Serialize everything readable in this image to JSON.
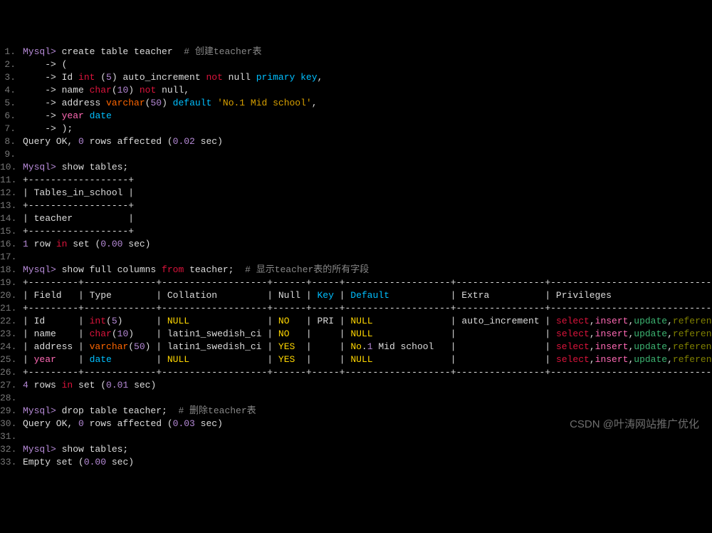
{
  "lines": {
    "1": {
      "num": "1.",
      "parts": [
        {
          "t": "Mysql>",
          "c": "prompt"
        },
        {
          "t": " create table teacher  ",
          "c": "white"
        },
        {
          "t": "# 创建teacher表",
          "c": "comment"
        }
      ]
    },
    "2": {
      "num": "2.",
      "parts": [
        {
          "t": "    -> (",
          "c": "white"
        }
      ]
    },
    "3": {
      "num": "3.",
      "parts": [
        {
          "t": "    -> Id ",
          "c": "white"
        },
        {
          "t": "int",
          "c": "kw-red"
        },
        {
          "t": " (",
          "c": "white"
        },
        {
          "t": "5",
          "c": "num"
        },
        {
          "t": ") auto_increment ",
          "c": "white"
        },
        {
          "t": "not",
          "c": "kw-red"
        },
        {
          "t": " null ",
          "c": "white"
        },
        {
          "t": "primary",
          "c": "kw-cyan"
        },
        {
          "t": " ",
          "c": "white"
        },
        {
          "t": "key",
          "c": "kw-cyan"
        },
        {
          "t": ",",
          "c": "white"
        }
      ]
    },
    "4": {
      "num": "4.",
      "parts": [
        {
          "t": "    -> name ",
          "c": "white"
        },
        {
          "t": "char",
          "c": "kw-red"
        },
        {
          "t": "(",
          "c": "white"
        },
        {
          "t": "10",
          "c": "num"
        },
        {
          "t": ") ",
          "c": "white"
        },
        {
          "t": "not",
          "c": "kw-red"
        },
        {
          "t": " null,",
          "c": "white"
        }
      ]
    },
    "5": {
      "num": "5.",
      "parts": [
        {
          "t": "    -> address ",
          "c": "white"
        },
        {
          "t": "varchar",
          "c": "kw-orange"
        },
        {
          "t": "(",
          "c": "white"
        },
        {
          "t": "50",
          "c": "num"
        },
        {
          "t": ") ",
          "c": "white"
        },
        {
          "t": "default",
          "c": "kw-cyan"
        },
        {
          "t": " ",
          "c": "white"
        },
        {
          "t": "'No.1 Mid school'",
          "c": "str"
        },
        {
          "t": ",",
          "c": "white"
        }
      ]
    },
    "6": {
      "num": "6.",
      "parts": [
        {
          "t": "    -> ",
          "c": "white"
        },
        {
          "t": "year",
          "c": "kw-pink"
        },
        {
          "t": " ",
          "c": "white"
        },
        {
          "t": "date",
          "c": "kw-cyan"
        }
      ]
    },
    "7": {
      "num": "7.",
      "parts": [
        {
          "t": "    -> );",
          "c": "white"
        }
      ]
    },
    "8": {
      "num": "8.",
      "parts": [
        {
          "t": "Query OK, ",
          "c": "white"
        },
        {
          "t": "0",
          "c": "num"
        },
        {
          "t": " rows affected (",
          "c": "white"
        },
        {
          "t": "0.02",
          "c": "num"
        },
        {
          "t": " sec)",
          "c": "white"
        }
      ]
    },
    "9": {
      "num": "9.",
      "parts": [
        {
          "t": "",
          "c": "white"
        }
      ]
    },
    "10": {
      "num": "10.",
      "parts": [
        {
          "t": "Mysql>",
          "c": "prompt"
        },
        {
          "t": " show tables;",
          "c": "white"
        }
      ]
    },
    "11": {
      "num": "11.",
      "parts": [
        {
          "t": "+------------------+",
          "c": "white"
        }
      ]
    },
    "12": {
      "num": "12.",
      "parts": [
        {
          "t": "| Tables_in_school |",
          "c": "white"
        }
      ]
    },
    "13": {
      "num": "13.",
      "parts": [
        {
          "t": "+------------------+",
          "c": "white"
        }
      ]
    },
    "14": {
      "num": "14.",
      "parts": [
        {
          "t": "| teacher          |",
          "c": "white"
        }
      ]
    },
    "15": {
      "num": "15.",
      "parts": [
        {
          "t": "+------------------+",
          "c": "white"
        }
      ]
    },
    "16": {
      "num": "16.",
      "parts": [
        {
          "t": "1",
          "c": "num"
        },
        {
          "t": " row ",
          "c": "white"
        },
        {
          "t": "in",
          "c": "kw-red"
        },
        {
          "t": " set (",
          "c": "white"
        },
        {
          "t": "0.00",
          "c": "num"
        },
        {
          "t": " sec)",
          "c": "white"
        }
      ]
    },
    "17": {
      "num": "17.",
      "parts": [
        {
          "t": "",
          "c": "white"
        }
      ]
    },
    "18": {
      "num": "18.",
      "parts": [
        {
          "t": "Mysql>",
          "c": "prompt"
        },
        {
          "t": " show full columns ",
          "c": "white"
        },
        {
          "t": "from",
          "c": "kw-red"
        },
        {
          "t": " teacher;  ",
          "c": "white"
        },
        {
          "t": "# 显示teacher表的所有字段",
          "c": "comment"
        }
      ]
    },
    "19": {
      "num": "19.",
      "parts": [
        {
          "t": "+---------+-------------+-------------------+------+-----+-------------------+----------------+---------------------------------+---------+",
          "c": "white"
        }
      ]
    },
    "20": {
      "num": "20.",
      "parts": [
        {
          "t": "| Field   | Type        | Collation         | Null | ",
          "c": "white"
        },
        {
          "t": "Key",
          "c": "kw-cyan"
        },
        {
          "t": " | ",
          "c": "white"
        },
        {
          "t": "Default",
          "c": "kw-cyan"
        },
        {
          "t": "           | Extra          | Privileges                      | Comment |",
          "c": "white"
        }
      ]
    },
    "21": {
      "num": "21.",
      "parts": [
        {
          "t": "+---------+-------------+-------------------+------+-----+-------------------+----------------+---------------------------------+---------+",
          "c": "white"
        }
      ]
    },
    "22": {
      "num": "22.",
      "parts": [
        {
          "t": "| Id      | ",
          "c": "white"
        },
        {
          "t": "int",
          "c": "kw-red"
        },
        {
          "t": "(",
          "c": "white"
        },
        {
          "t": "5",
          "c": "num"
        },
        {
          "t": ")      | ",
          "c": "white"
        },
        {
          "t": "NULL",
          "c": "kw-yellow"
        },
        {
          "t": "              | ",
          "c": "white"
        },
        {
          "t": "NO",
          "c": "kw-yellow"
        },
        {
          "t": "   | PRI | ",
          "c": "white"
        },
        {
          "t": "NULL",
          "c": "kw-yellow"
        },
        {
          "t": "              | auto_increment | ",
          "c": "white"
        },
        {
          "t": "select",
          "c": "kw-red"
        },
        {
          "t": ",",
          "c": "white"
        },
        {
          "t": "insert",
          "c": "kw-pink"
        },
        {
          "t": ",",
          "c": "white"
        },
        {
          "t": "update",
          "c": "kw-green"
        },
        {
          "t": ",",
          "c": "white"
        },
        {
          "t": "references",
          "c": "kw-olive"
        },
        {
          "t": " |         |",
          "c": "white"
        }
      ]
    },
    "23": {
      "num": "23.",
      "parts": [
        {
          "t": "| name    | ",
          "c": "white"
        },
        {
          "t": "char",
          "c": "kw-red"
        },
        {
          "t": "(",
          "c": "white"
        },
        {
          "t": "10",
          "c": "num"
        },
        {
          "t": ")    | latin1_swedish_ci | ",
          "c": "white"
        },
        {
          "t": "NO",
          "c": "kw-yellow"
        },
        {
          "t": "   |     | ",
          "c": "white"
        },
        {
          "t": "NULL",
          "c": "kw-yellow"
        },
        {
          "t": "              |                | ",
          "c": "white"
        },
        {
          "t": "select",
          "c": "kw-red"
        },
        {
          "t": ",",
          "c": "white"
        },
        {
          "t": "insert",
          "c": "kw-pink"
        },
        {
          "t": ",",
          "c": "white"
        },
        {
          "t": "update",
          "c": "kw-green"
        },
        {
          "t": ",",
          "c": "white"
        },
        {
          "t": "references",
          "c": "kw-olive"
        },
        {
          "t": " |         |",
          "c": "white"
        }
      ]
    },
    "24": {
      "num": "24.",
      "parts": [
        {
          "t": "| address | ",
          "c": "white"
        },
        {
          "t": "varchar",
          "c": "kw-orange"
        },
        {
          "t": "(",
          "c": "white"
        },
        {
          "t": "50",
          "c": "num"
        },
        {
          "t": ") | latin1_swedish_ci | ",
          "c": "white"
        },
        {
          "t": "YES",
          "c": "kw-yellow"
        },
        {
          "t": "  |     | ",
          "c": "white"
        },
        {
          "t": "No",
          "c": "kw-yellow"
        },
        {
          "t": ".",
          "c": "white"
        },
        {
          "t": "1",
          "c": "num"
        },
        {
          "t": " Mid school   |                | ",
          "c": "white"
        },
        {
          "t": "select",
          "c": "kw-red"
        },
        {
          "t": ",",
          "c": "white"
        },
        {
          "t": "insert",
          "c": "kw-pink"
        },
        {
          "t": ",",
          "c": "white"
        },
        {
          "t": "update",
          "c": "kw-green"
        },
        {
          "t": ",",
          "c": "white"
        },
        {
          "t": "references",
          "c": "kw-olive"
        },
        {
          "t": " |         |",
          "c": "white"
        }
      ]
    },
    "25": {
      "num": "25.",
      "parts": [
        {
          "t": "| ",
          "c": "white"
        },
        {
          "t": "year",
          "c": "kw-pink"
        },
        {
          "t": "    | ",
          "c": "white"
        },
        {
          "t": "date",
          "c": "kw-cyan"
        },
        {
          "t": "        | ",
          "c": "white"
        },
        {
          "t": "NULL",
          "c": "kw-yellow"
        },
        {
          "t": "              | ",
          "c": "white"
        },
        {
          "t": "YES",
          "c": "kw-yellow"
        },
        {
          "t": "  |     | ",
          "c": "white"
        },
        {
          "t": "NULL",
          "c": "kw-yellow"
        },
        {
          "t": "              |                | ",
          "c": "white"
        },
        {
          "t": "select",
          "c": "kw-red"
        },
        {
          "t": ",",
          "c": "white"
        },
        {
          "t": "insert",
          "c": "kw-pink"
        },
        {
          "t": ",",
          "c": "white"
        },
        {
          "t": "update",
          "c": "kw-green"
        },
        {
          "t": ",",
          "c": "white"
        },
        {
          "t": "references",
          "c": "kw-olive"
        },
        {
          "t": " |         |",
          "c": "white"
        }
      ]
    },
    "26": {
      "num": "26.",
      "parts": [
        {
          "t": "+---------+-------------+-------------------+------+-----+-------------------+----------------+---------------------------------+---------+",
          "c": "white"
        }
      ]
    },
    "27": {
      "num": "27.",
      "parts": [
        {
          "t": "4",
          "c": "num"
        },
        {
          "t": " rows ",
          "c": "white"
        },
        {
          "t": "in",
          "c": "kw-red"
        },
        {
          "t": " set (",
          "c": "white"
        },
        {
          "t": "0.01",
          "c": "num"
        },
        {
          "t": " sec)",
          "c": "white"
        }
      ]
    },
    "28": {
      "num": "28.",
      "parts": [
        {
          "t": "",
          "c": "white"
        }
      ]
    },
    "29": {
      "num": "29.",
      "parts": [
        {
          "t": "Mysql>",
          "c": "prompt"
        },
        {
          "t": " drop table teacher;  ",
          "c": "white"
        },
        {
          "t": "# 删除teacher表",
          "c": "comment"
        }
      ]
    },
    "30": {
      "num": "30.",
      "parts": [
        {
          "t": "Query OK, ",
          "c": "white"
        },
        {
          "t": "0",
          "c": "num"
        },
        {
          "t": " rows affected (",
          "c": "white"
        },
        {
          "t": "0.03",
          "c": "num"
        },
        {
          "t": " sec)",
          "c": "white"
        }
      ]
    },
    "31": {
      "num": "31.",
      "parts": [
        {
          "t": "",
          "c": "white"
        }
      ]
    },
    "32": {
      "num": "32.",
      "parts": [
        {
          "t": "Mysql>",
          "c": "prompt"
        },
        {
          "t": " show tables;",
          "c": "white"
        }
      ]
    },
    "33": {
      "num": "33.",
      "parts": [
        {
          "t": "Empty set (",
          "c": "white"
        },
        {
          "t": "0.00",
          "c": "num"
        },
        {
          "t": " sec)",
          "c": "white"
        }
      ]
    }
  },
  "watermark": "CSDN @叶涛网站推广优化"
}
